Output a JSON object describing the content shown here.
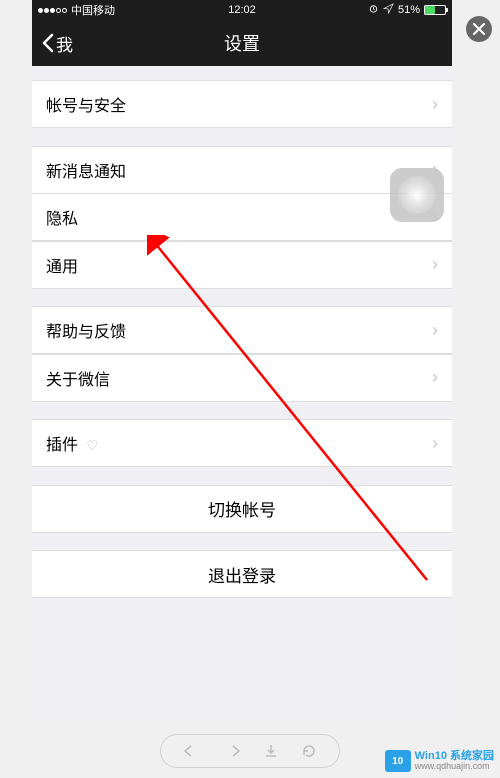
{
  "statusBar": {
    "carrier": "中国移动",
    "time": "12:02",
    "batteryPercent": "51%",
    "batteryLevel": 51
  },
  "nav": {
    "back": "我",
    "title": "设置"
  },
  "groups": [
    {
      "items": [
        {
          "label": "帐号与安全"
        }
      ]
    },
    {
      "items": [
        {
          "label": "新消息通知"
        },
        {
          "label": "隐私"
        },
        {
          "label": "通用"
        }
      ]
    },
    {
      "items": [
        {
          "label": "帮助与反馈"
        },
        {
          "label": "关于微信"
        }
      ]
    },
    {
      "items": [
        {
          "label": "插件",
          "hasBulb": true
        }
      ]
    }
  ],
  "actions": {
    "switchAccount": "切换帐号",
    "logout": "退出登录"
  },
  "watermark": {
    "title": "Win10 系统家园",
    "url": "www.qdhuajin.com",
    "logo": "10"
  }
}
